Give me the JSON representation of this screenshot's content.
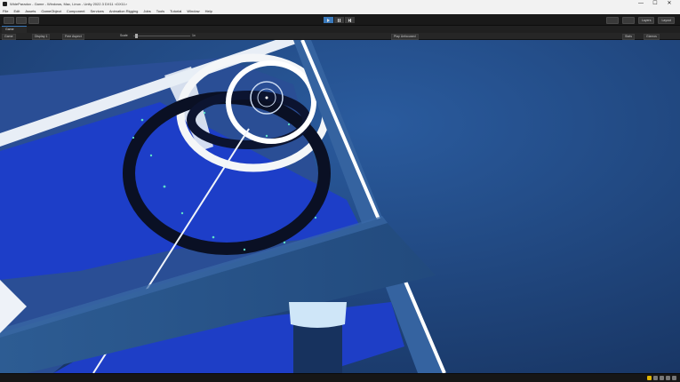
{
  "window": {
    "title": "WideParadox - Game - Windows, Mac, Linux - Unity 2022.3 DX11 <DX11>",
    "controls": [
      "—",
      "☐",
      "✕"
    ]
  },
  "menu": [
    "File",
    "Edit",
    "Assets",
    "GameObject",
    "Component",
    "Services",
    "Animation Rigging",
    "Jobs",
    "Tools",
    "Tutorial",
    "Window",
    "Help"
  ],
  "toolbar": {
    "layers_label": "Layers",
    "layout_label": "Layout"
  },
  "game_view": {
    "tab_label": "Game",
    "display_label": "Game",
    "display_select": "Display 1",
    "aspect_select": "Free Aspect",
    "scale_label": "Scale",
    "scale_value": "1x",
    "play_focused": "Play Unfocused",
    "stats_label": "Stats",
    "gizmos_label": "Gizmos"
  },
  "icons": [
    "unity-logo-icon",
    "play-icon",
    "pause-icon",
    "step-icon",
    "warning-icon"
  ],
  "colors": {
    "accent": "#3a79bb",
    "scene_blue": "#2a559e",
    "sky_blue": "#1f3f74",
    "warning": "#e0b400"
  }
}
